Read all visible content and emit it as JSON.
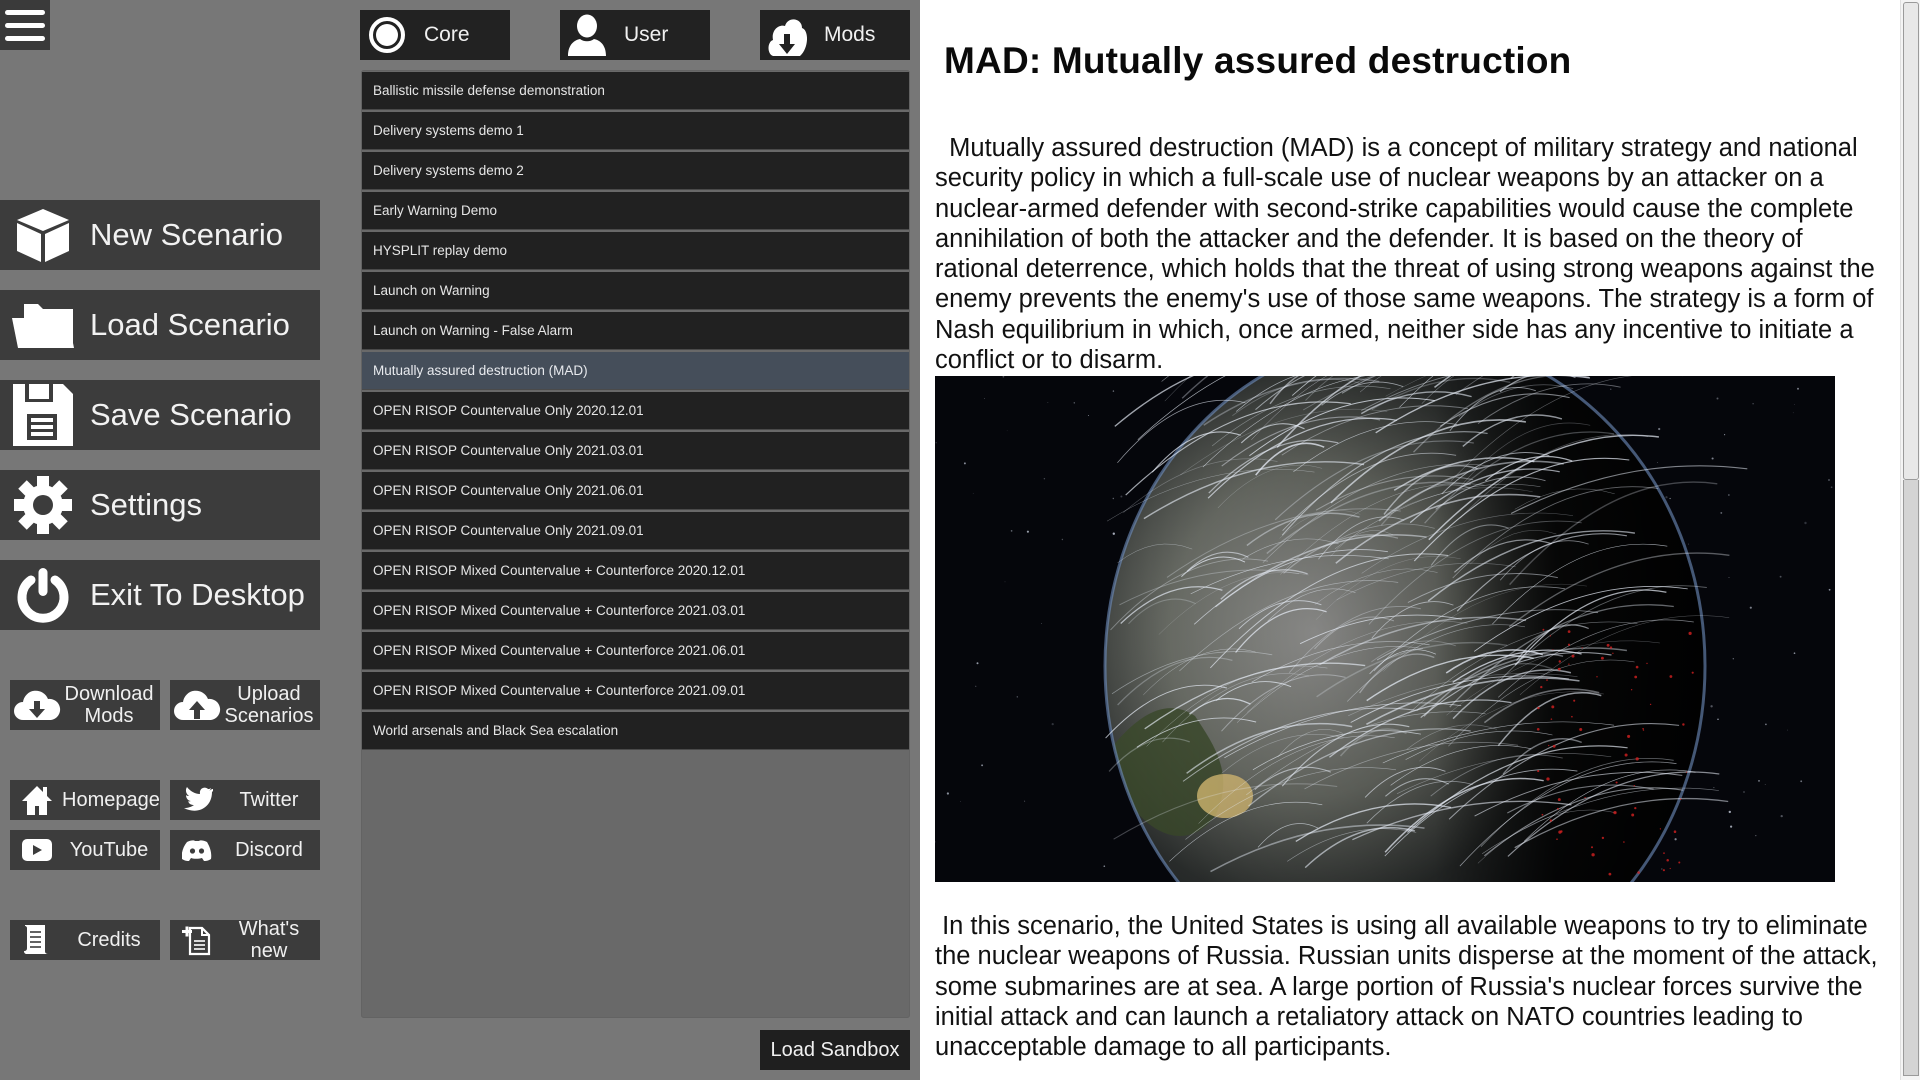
{
  "menu": {
    "hamburger_icon": "hamburger-menu-icon",
    "main_buttons": [
      {
        "id": "new",
        "label": "New Scenario",
        "icon": "cube-icon"
      },
      {
        "id": "load",
        "label": "Load Scenario",
        "icon": "folder-icon"
      },
      {
        "id": "save",
        "label": "Save Scenario",
        "icon": "floppy-disk-icon"
      },
      {
        "id": "settings",
        "label": "Settings",
        "icon": "gear-icon"
      },
      {
        "id": "exit",
        "label": "Exit To Desktop",
        "icon": "power-icon"
      }
    ],
    "download_mods": {
      "line1": "Download",
      "line2": "Mods",
      "icon": "cloud-download-icon"
    },
    "upload_scenarios": {
      "line1": "Upload",
      "line2": "Scenarios",
      "icon": "cloud-upload-icon"
    },
    "links": [
      {
        "id": "homepage",
        "label": "Homepage",
        "icon": "home-icon"
      },
      {
        "id": "twitter",
        "label": "Twitter",
        "icon": "twitter-bird-icon"
      },
      {
        "id": "youtube",
        "label": "YouTube",
        "icon": "youtube-play-icon"
      },
      {
        "id": "discord",
        "label": "Discord",
        "icon": "discord-icon"
      }
    ],
    "credits": {
      "label": "Credits",
      "icon": "scroll-icon"
    },
    "whats_new": {
      "label": "What's new",
      "icon": "new-document-icon"
    }
  },
  "scenario_tabs": [
    {
      "id": "core",
      "label": "Core",
      "icon": "circle-target-icon"
    },
    {
      "id": "user",
      "label": "User",
      "icon": "user-icon"
    },
    {
      "id": "mods",
      "label": "Mods",
      "icon": "cloud-download-icon"
    }
  ],
  "scenarios": [
    "Ballistic missile defense demonstration",
    "Delivery systems demo 1",
    "Delivery systems demo 2",
    "Early Warning Demo",
    "HYSPLIT replay demo",
    "Launch on Warning",
    "Launch on Warning - False Alarm",
    "Mutually assured destruction (MAD)",
    "OPEN RISOP Countervalue Only 2020.12.01",
    "OPEN RISOP Countervalue Only 2021.03.01",
    "OPEN RISOP Countervalue Only 2021.06.01",
    "OPEN RISOP Countervalue Only 2021.09.01",
    "OPEN RISOP Mixed Countervalue + Counterforce 2020.12.01",
    "OPEN RISOP Mixed Countervalue + Counterforce 2021.03.01",
    "OPEN RISOP Mixed Countervalue + Counterforce 2021.06.01",
    "OPEN RISOP Mixed Countervalue + Counterforce 2021.09.01",
    "World arsenals and Black Sea escalation"
  ],
  "selected_scenario": "Mutually assured destruction (MAD)",
  "load_sandbox_label": "Load Sandbox",
  "description": {
    "title": "MAD: Mutually assured destruction",
    "paragraph1": "  Mutually assured destruction (MAD) is a concept of military strategy and national security policy in which a full-scale use of nuclear weapons by an attacker on a nuclear-armed defender with second-strike capabilities would cause the complete annihilation of both the attacker and the defender. It is based on the theory of rational deterrence, which holds that the threat of using strong weapons against the enemy prevents the enemy's use of those same weapons. The strategy is a form of Nash equilibrium in which, once armed, neither side has any incentive to initiate a conflict or to disarm.",
    "image_alt": "Globe view of Earth with many missile trajectories arcing from North America over the pole toward Russia",
    "paragraph2": " In this scenario, the United States is using all available weapons to try to eliminate the nuclear weapons of Russia. Russian units disperse at the moment of the attack, some submarines are at sea. A large portion of Russia's nuclear forces survive the initial attack and can launch a retaliatory attack on NATO countries leading to unacceptable damage to all participants."
  },
  "colors": {
    "background": "#777777",
    "button_dark": "#3c3c3c",
    "list_row": "#212121",
    "list_row_selected": "#454e5a",
    "panel": "#ffffff"
  }
}
